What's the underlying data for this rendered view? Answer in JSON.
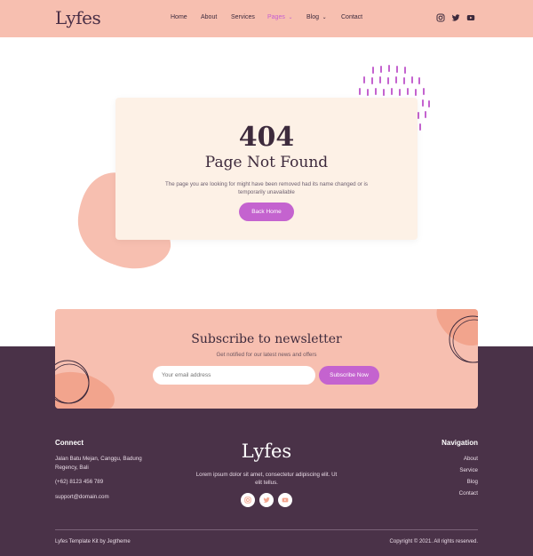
{
  "header": {
    "logo": "Lyfes",
    "nav": [
      {
        "label": "Home"
      },
      {
        "label": "About"
      },
      {
        "label": "Services"
      },
      {
        "label": "Pages"
      },
      {
        "label": "Blog"
      },
      {
        "label": "Contact"
      }
    ],
    "social": [
      "instagram-icon",
      "twitter-icon",
      "youtube-icon"
    ]
  },
  "error": {
    "code": "404",
    "title": "Page Not Found",
    "message": "The page you are looking for might have been removed had its name changed or is temporarily unavailable",
    "button": "Back Home"
  },
  "newsletter": {
    "title": "Subscribe to newsletter",
    "subtitle": "Get notified for our latest news and offers",
    "email_placeholder": "Your email address",
    "button": "Subscribe Now"
  },
  "footer": {
    "connect_title": "Connect",
    "address": "Jalan Batu Mejan, Canggu, Badung Regency, Bali",
    "phone": "(+62) 8123 456 789",
    "email": "support@domain.com",
    "logo": "Lyfes",
    "description": "Lorem ipsum dolor sit amet, consectetur adipiscing elit. Ut elit tellus.",
    "navigation_title": "Navigation",
    "links": [
      "About",
      "Service",
      "Blog",
      "Contact"
    ],
    "credit": "Lyfes Template Kit by Jegtheme",
    "copyright": "Copyright © 2021. All rights reserved."
  },
  "colors": {
    "peach": "#f7bfb0",
    "cream": "#fdf1e6",
    "plum": "#4a3248",
    "purple": "#c463cf",
    "coral": "#f2a48d"
  }
}
